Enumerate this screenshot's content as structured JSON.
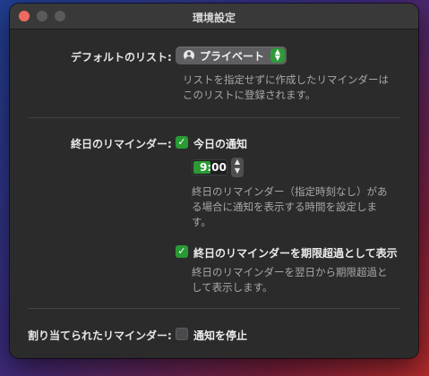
{
  "window": {
    "title": "環境設定"
  },
  "default_list": {
    "label": "デフォルトのリスト:",
    "selected": "プライベート",
    "icon": "person-circle-icon",
    "help_line1": "リストを指定せずに作成したリマインダーは",
    "help_line2": "このリストに登録されます。"
  },
  "all_day": {
    "label": "終日のリマインダー:",
    "today_label": "今日の通知",
    "today_checked": true,
    "time": "9:00",
    "time_help_line1": "終日のリマインダー（指定時刻なし）があ",
    "time_help_line2": "る場合に通知を表示する時間を設定しま",
    "time_help_line3": "す。",
    "overdue_label": "終日のリマインダーを期限超過として表示",
    "overdue_checked": true,
    "overdue_help_line1": "終日のリマインダーを翌日から期限超過と",
    "overdue_help_line2": "して表示します。"
  },
  "assigned": {
    "label": "割り当てられたリマインダー:",
    "mute_label": "通知を停止",
    "mute_checked": false
  },
  "colors": {
    "accent": "#2a9a35",
    "close": "#ed6a5e"
  }
}
